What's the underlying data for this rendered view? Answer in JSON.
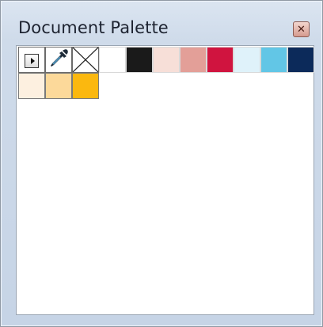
{
  "window": {
    "title": "Document Palette",
    "close_icon": "close-icon"
  },
  "tools": [
    {
      "name": "palette-menu-icon",
      "icon": "menu-arrow-icon"
    },
    {
      "name": "eyedropper-icon",
      "icon": "eyedropper-icon"
    },
    {
      "name": "no-color-swatch",
      "icon": "no-color-icon"
    }
  ],
  "colors": [
    "#ffffff",
    "#1a1a1a",
    "#f7dfd8",
    "#e39f98",
    "#d0143f",
    "#dff2fa",
    "#62c6e6",
    "#0c2a5a",
    "#fdf0e0",
    "#fcd99a",
    "#fbb80f"
  ]
}
